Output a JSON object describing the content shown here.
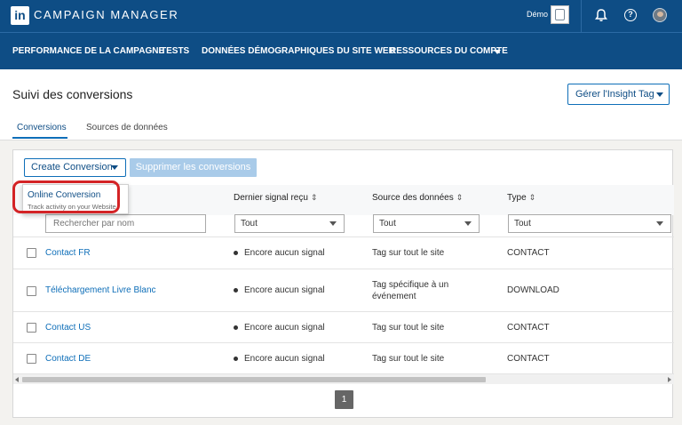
{
  "app": {
    "title": "CAMPAIGN MANAGER",
    "logo_text": "in",
    "account_label": "Démo"
  },
  "icons": {
    "bell": "bell-icon",
    "help": "help-icon",
    "user": "user-avatar",
    "sort": "sort-icon",
    "caret": "caret-down-icon"
  },
  "colors": {
    "brand": "#0e4d85",
    "link": "#0e6eb8",
    "highlight": "#d42326"
  },
  "nav": {
    "items": [
      {
        "label": "PERFORMANCE DE LA CAMPAGNE"
      },
      {
        "label": "TESTS"
      },
      {
        "label": "DONNÉES DÉMOGRAPHIQUES DU SITE WEB"
      },
      {
        "label": "RESSOURCES DU COMPTE"
      }
    ],
    "help_glyph": "?"
  },
  "page": {
    "title": "Suivi des conversions",
    "insight_button": "Gérer l'Insight Tag",
    "tabs": [
      {
        "label": "Conversions"
      },
      {
        "label": "Sources de données"
      }
    ]
  },
  "toolbar": {
    "create_label": "Create Conversion",
    "delete_label": "Supprimer les conversions"
  },
  "dropdown_menu": {
    "items": [
      {
        "title": "Online Conversion",
        "subtitle": "Track activity on your Website"
      }
    ]
  },
  "table": {
    "columns": [
      {
        "label": "Dernier signal reçu"
      },
      {
        "label": "Source des données"
      },
      {
        "label": "Type"
      }
    ],
    "sort_glyph": "⇕",
    "filters": {
      "search_placeholder": "Rechercher par nom",
      "signal": "Tout",
      "source": "Tout",
      "type": "Tout"
    },
    "rows": [
      {
        "name": "Contact FR",
        "signal": "Encore aucun signal",
        "source": "Tag sur tout le site",
        "type": "CONTACT"
      },
      {
        "name": "Téléchargement Livre Blanc",
        "signal": "Encore aucun signal",
        "source": "Tag spécifique à un événement",
        "type": "DOWNLOAD"
      },
      {
        "name": "Contact US",
        "signal": "Encore aucun signal",
        "source": "Tag sur tout le site",
        "type": "CONTACT"
      },
      {
        "name": "Contact DE",
        "signal": "Encore aucun signal",
        "source": "Tag sur tout le site",
        "type": "CONTACT"
      }
    ]
  },
  "pagination": {
    "current": "1"
  }
}
